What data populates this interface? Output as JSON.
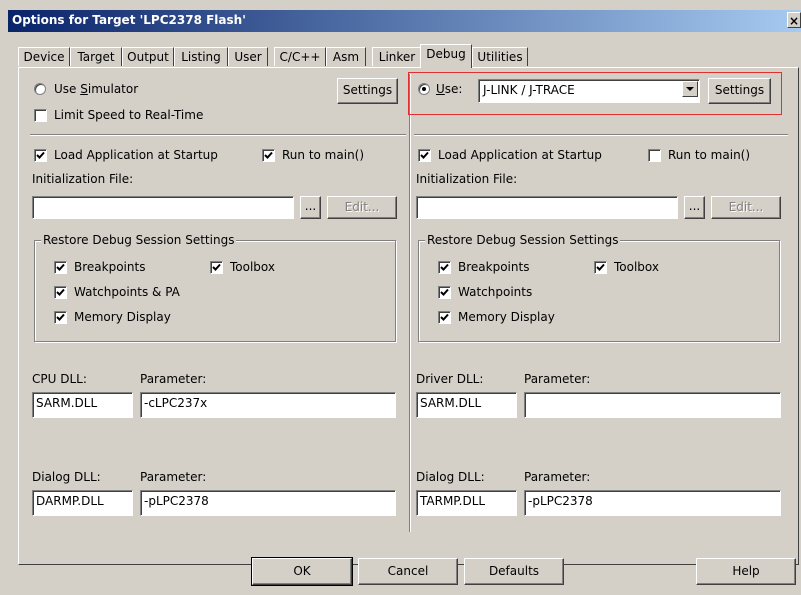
{
  "window": {
    "title": "Options for Target 'LPC2378 Flash'",
    "close_glyph": "×"
  },
  "tabs": [
    "Device",
    "Target",
    "Output",
    "Listing",
    "User",
    "C/C++",
    "Asm",
    "Linker",
    "Debug",
    "Utilities"
  ],
  "active_tab": "Debug",
  "left": {
    "use_simulator_pre": "Use ",
    "use_simulator_u": "S",
    "use_simulator_post": "imulator",
    "settings_label": "Settings",
    "limit_speed_label": "Limit Speed to Real-Time",
    "load_app_label": "Load Application at Startup",
    "run_to_main_label": "Run to main()",
    "init_file_label": "Initialization File:",
    "init_file_value": "",
    "browse_label": "...",
    "edit_label": "Edit...",
    "restore_group_label": "Restore Debug Session Settings",
    "breakpoints_label": "Breakpoints",
    "toolbox_label": "Toolbox",
    "watchpoints_label": "Watchpoints & PA",
    "memory_label": "Memory Display",
    "cpu_dll_label": "CPU DLL:",
    "cpu_param_label": "Parameter:",
    "cpu_dll_value": "SARM.DLL",
    "cpu_param_value": "-cLPC237x",
    "dialog_dll_label": "Dialog DLL:",
    "dialog_param_label": "Parameter:",
    "dialog_dll_value": "DARMP.DLL",
    "dialog_param_value": "-pLPC2378"
  },
  "right": {
    "use_pre": "",
    "use_u": "U",
    "use_post": "se:",
    "driver_value": "J-LINK / J-TRACE",
    "settings_label": "Settings",
    "load_app_label": "Load Application at Startup",
    "run_to_main_label": "Run to main()",
    "init_file_label": "Initialization File:",
    "init_file_value": "",
    "browse_label": "...",
    "edit_label": "Edit...",
    "restore_group_label": "Restore Debug Session Settings",
    "breakpoints_label": "Breakpoints",
    "toolbox_label": "Toolbox",
    "watchpoints_label": "Watchpoints",
    "memory_label": "Memory Display",
    "driver_dll_label": "Driver DLL:",
    "driver_param_label": "Parameter:",
    "driver_dll_value": "SARM.DLL",
    "driver_param_value": "",
    "dialog_dll_label": "Dialog DLL:",
    "dialog_param_label": "Parameter:",
    "dialog_dll_value": "TARMP.DLL",
    "dialog_param_value": "-pLPC2378"
  },
  "buttons": {
    "ok": "OK",
    "cancel": "Cancel",
    "defaults": "Defaults",
    "help": "Help"
  },
  "checkbox_states": {
    "left_limit_speed": false,
    "left_load_app": true,
    "left_run_to_main": true,
    "left_breakpoints": true,
    "left_toolbox": true,
    "left_watchpoints": true,
    "left_memory": true,
    "right_load_app": true,
    "right_run_to_main": false,
    "right_breakpoints": true,
    "right_toolbox": true,
    "right_watchpoints": true,
    "right_memory": true
  },
  "radio_selected": "use_target_driver",
  "highlight_color": "#e03030"
}
